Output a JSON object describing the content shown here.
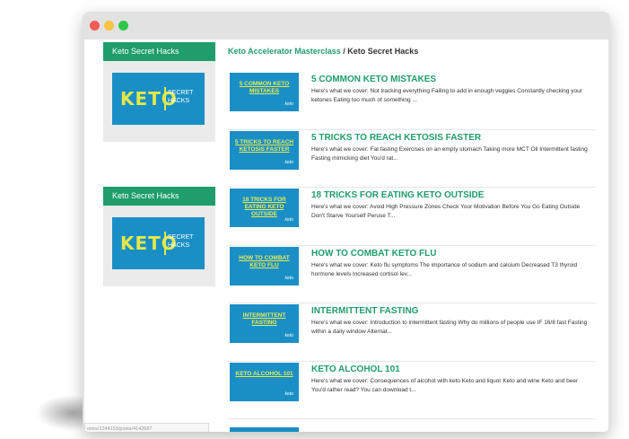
{
  "sidebar": [
    {
      "heading": "Keto Secret Hacks",
      "logo_main": "KETO",
      "logo_sub1": "SECRET",
      "logo_sub2": "HACKS"
    },
    {
      "heading": "Keto Secret Hacks",
      "logo_main": "KETO",
      "logo_sub1": "SECRET",
      "logo_sub2": "HACKS"
    }
  ],
  "breadcrumb": {
    "link": "Keto Accelerator Masterclass",
    "separator": "/",
    "current": "Keto Secret Hacks"
  },
  "lessons": [
    {
      "thumb": "5 COMMON KETO MISTAKES",
      "title": "5 COMMON KETO MISTAKES",
      "desc": "Here's what we cover: Not tracking everything Failing to add in enough veggies Constantly checking your ketones Eating too much of something ..."
    },
    {
      "thumb": "5 TRICKS TO REACH KETOSIS FASTER",
      "title": "5 TRICKS TO REACH KETOSIS FASTER",
      "desc": "Here's what we cover: Fat fasting Exercises on an empty stomach Taking more MCT Oil Intermittent fasting Fasting mimicking diet You'd rat..."
    },
    {
      "thumb": "18 TRICKS FOR EATING KETO OUTSIDE",
      "title": "18 TRICKS FOR EATING KETO OUTSIDE",
      "desc": "Here's what we cover: Avoid High Pressure Zones Check Your Motivation Before You Go Eating Outside Don't Starve Yourself Peruse T..."
    },
    {
      "thumb": "HOW TO COMBAT KETO FLU",
      "title": "HOW TO COMBAT KETO FLU",
      "desc": "Here's what we cover: Keto flu symptoms The importance of sodium and calcium Decreased T3 thyroid hormone levels Increased cortisol lev..."
    },
    {
      "thumb": "INTERMITTENT FASTING",
      "title": "INTERMITTENT FASTING",
      "desc": "Here's what we cover: Introduction to intermittent fasting Why do millions of people use IF 16/8 fast Fasting within a daily window Alternat..."
    },
    {
      "thumb": "KETO ALCOHOL 101",
      "title": "KETO ALCOHOL 101",
      "desc": "Here's what we cover: Consequences of alcohol with keto Keto and liquor Keto and wine Keto and beer You'd rather read? You can download t..."
    }
  ],
  "thumb_mark": "keto",
  "status_url": "ories/1244153/posts/4142687",
  "colors": {
    "accent": "#1f9d6b",
    "thumb_bg": "#1a8fc6",
    "thumb_text": "#e7ea52"
  }
}
